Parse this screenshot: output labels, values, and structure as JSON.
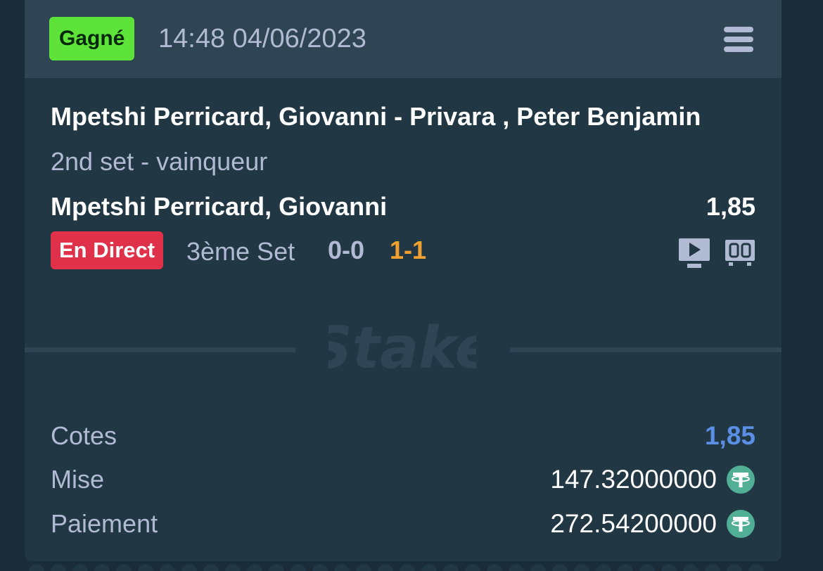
{
  "bet": {
    "status": "Gagné",
    "datetime": "14:48 04/06/2023",
    "match": "Mpetshi Perricard, Giovanni - Privara , Peter Benjamin",
    "market": "2nd set - vainqueur",
    "selection": "Mpetshi Perricard, Giovanni",
    "selection_odds": "1,85",
    "live_label": "En Direct",
    "set_label": "3ème Set",
    "score_sets": "0-0",
    "score_games": "1-1"
  },
  "icons": {
    "menu": "menu-icon",
    "stream": "live-stream-icon",
    "scoreboard": "scoreboard-icon",
    "currency": "tether-usdt-icon"
  },
  "watermark": "Stake",
  "summary": {
    "odds_label": "Cotes",
    "odds_value": "1,85",
    "stake_label": "Mise",
    "stake_value": "147.32000000",
    "payout_label": "Paiement",
    "payout_value": "272.54200000"
  },
  "colors": {
    "won_badge": "#5ee33a",
    "live_badge": "#e0314a",
    "game_score": "#f0a031",
    "odds_accent": "#5b8fe6",
    "currency": "#50af95"
  }
}
